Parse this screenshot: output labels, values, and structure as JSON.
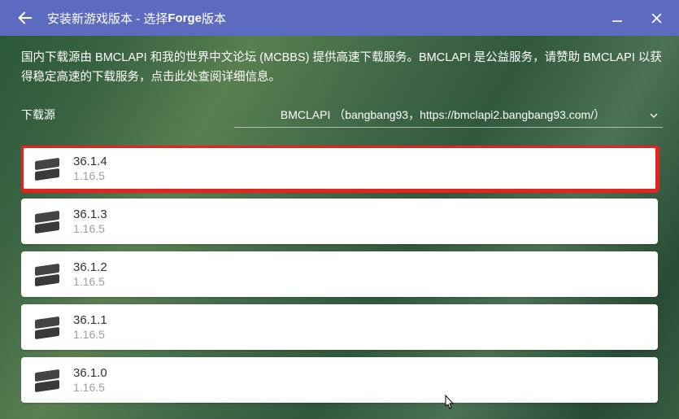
{
  "titlebar": {
    "title_prefix": "安装新游戏版本 - 选择 ",
    "title_bold": "Forge",
    "title_suffix": " 版本"
  },
  "info_text": "国内下载源由 BMCLAPI 和我的世界中文论坛 (MCBBS) 提供高速下载服务。BMCLAPI 是公益服务，请赞助 BMCLAPI 以获得稳定高速的下载服务，点击此处查阅详细信息。",
  "source": {
    "label": "下载源",
    "selected": "BMCLAPI （bangbang93，https://bmclapi2.bangbang93.com/）"
  },
  "versions": [
    {
      "version": "36.1.4",
      "mc": "1.16.5",
      "highlight": true
    },
    {
      "version": "36.1.3",
      "mc": "1.16.5",
      "highlight": false
    },
    {
      "version": "36.1.2",
      "mc": "1.16.5",
      "highlight": false
    },
    {
      "version": "36.1.1",
      "mc": "1.16.5",
      "highlight": false
    },
    {
      "version": "36.1.0",
      "mc": "1.16.5",
      "highlight": false
    }
  ]
}
